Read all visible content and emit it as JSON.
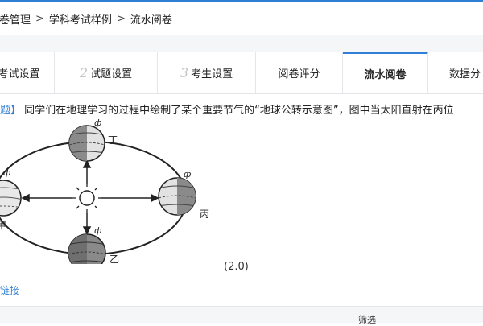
{
  "breadcrumb": {
    "items": [
      "试卷管理",
      "学科考试样例",
      "流水阅卷"
    ],
    "separator": ">"
  },
  "tabs": [
    {
      "label": "考试设置"
    },
    {
      "num": "2",
      "label": "试题设置"
    },
    {
      "num": "3",
      "label": "考生设置"
    },
    {
      "label": "阅卷评分"
    },
    {
      "label": "流水阅卷",
      "active": true
    },
    {
      "label": "数据分"
    }
  ],
  "question": {
    "tag": "题】",
    "text": "同学们在地理学习的过程中绘制了某个重要节气的“地球公转示意图”，图中当太阳直射在丙位"
  },
  "figure": {
    "labels": {
      "ding": "丁",
      "bing": "丙",
      "yi": "乙",
      "jia": "甲"
    }
  },
  "score": "(2.0)",
  "link": "链接",
  "table": {
    "col_header": "筛选"
  },
  "colors": {
    "accent": "#2f7fd6",
    "border": "#e4e6ea",
    "gray_bg": "#f5f6f8"
  }
}
